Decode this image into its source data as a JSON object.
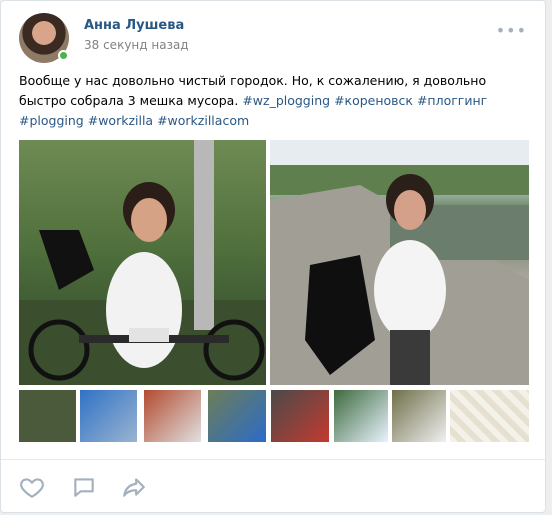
{
  "post": {
    "author": "Анна Лушева",
    "time": "38 секунд назад",
    "more": "•••",
    "text_plain": "Вообще у нас довольно чистый городок. Но, к сожалению, я довольно быстро собрала 3 мешка мусора.",
    "hashtags": [
      "#wz_plogging",
      "#кореновск",
      "#плоггинг",
      "#plogging",
      "#workzilla",
      "#workzillacom"
    ]
  },
  "colors": {
    "link": "#2a5885",
    "online": "#4bb34b",
    "icon": "#a5b0bd"
  },
  "icons": {
    "like": "heart-icon",
    "comment": "comment-icon",
    "share": "share-icon",
    "more": "more-dots-icon"
  }
}
